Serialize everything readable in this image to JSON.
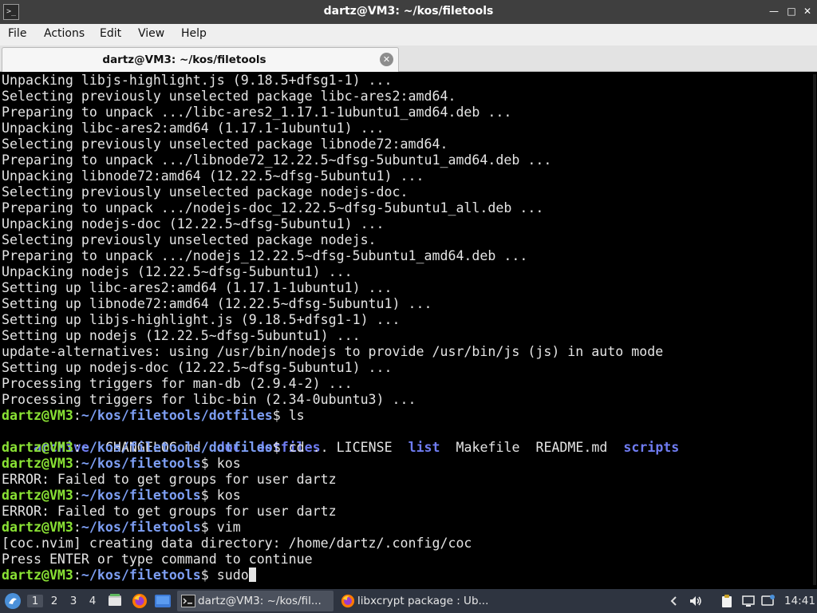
{
  "window": {
    "title": "dartz@VM3: ~/kos/filetools",
    "icon_glyph": ">_"
  },
  "menu": {
    "items": [
      "File",
      "Actions",
      "Edit",
      "View",
      "Help"
    ]
  },
  "tab": {
    "label": "dartz@VM3: ~/kos/filetools"
  },
  "terminal": {
    "output_lines": [
      "Unpacking libjs-highlight.js (9.18.5+dfsg1-1) ...",
      "Selecting previously unselected package libc-ares2:amd64.",
      "Preparing to unpack .../libc-ares2_1.17.1-1ubuntu1_amd64.deb ...",
      "Unpacking libc-ares2:amd64 (1.17.1-1ubuntu1) ...",
      "Selecting previously unselected package libnode72:amd64.",
      "Preparing to unpack .../libnode72_12.22.5~dfsg-5ubuntu1_amd64.deb ...",
      "Unpacking libnode72:amd64 (12.22.5~dfsg-5ubuntu1) ...",
      "Selecting previously unselected package nodejs-doc.",
      "Preparing to unpack .../nodejs-doc_12.22.5~dfsg-5ubuntu1_all.deb ...",
      "Unpacking nodejs-doc (12.22.5~dfsg-5ubuntu1) ...",
      "Selecting previously unselected package nodejs.",
      "Preparing to unpack .../nodejs_12.22.5~dfsg-5ubuntu1_amd64.deb ...",
      "Unpacking nodejs (12.22.5~dfsg-5ubuntu1) ...",
      "Setting up libc-ares2:amd64 (1.17.1-1ubuntu1) ...",
      "Setting up libnode72:amd64 (12.22.5~dfsg-5ubuntu1) ...",
      "Setting up libjs-highlight.js (9.18.5+dfsg1-1) ...",
      "Setting up nodejs (12.22.5~dfsg-5ubuntu1) ...",
      "update-alternatives: using /usr/bin/nodejs to provide /usr/bin/js (js) in auto mode",
      "Setting up nodejs-doc (12.22.5~dfsg-5ubuntu1) ...",
      "Processing triggers for man-db (2.9.4-2) ...",
      "Processing triggers for libc-bin (2.34-0ubuntu3) ..."
    ],
    "prompt_user": "dartz@VM3",
    "prompt_sep": ":",
    "prompt_path_dotfiles": "~/kos/filetools/dotfiles",
    "prompt_path_filetools": "~/kos/filetools",
    "prompt_end": "$ ",
    "cmd_ls": "ls",
    "ls_entries": [
      {
        "name": "archive",
        "dir": true
      },
      {
        "name": "CHANGELOG.md",
        "dir": false
      },
      {
        "name": "doc",
        "dir": true
      },
      {
        "name": "dotfiles",
        "dir": true
      },
      {
        "name": "LICENSE",
        "dir": false
      },
      {
        "name": "list",
        "dir": true
      },
      {
        "name": "Makefile",
        "dir": false
      },
      {
        "name": "README.md",
        "dir": false
      },
      {
        "name": "scripts",
        "dir": true
      }
    ],
    "cmd_cd": "cd ..",
    "cmd_kos": "kos",
    "error_groups": "ERROR: Failed to get groups for user dartz",
    "cmd_vim": "vim",
    "coc_msg": "[coc.nvim] creating data directory: /home/dartz/.config/coc",
    "press_enter": "Press ENTER or type command to continue",
    "cmd_current": "sudo"
  },
  "taskbar": {
    "workspaces": [
      "1",
      "2",
      "3",
      "4"
    ],
    "active_workspace": "1",
    "tasks": [
      {
        "label": "dartz@VM3: ~/kos/fil...",
        "icon": "terminal-icon"
      },
      {
        "label": "libxcrypt package : Ub...",
        "icon": "firefox-icon"
      }
    ],
    "clock": "14:41"
  },
  "colors": {
    "prompt_user": "#8ae234",
    "prompt_path": "#7d9ef3",
    "directory": "#6f7cf2",
    "taskbar_bg": "#2e3440",
    "titlebar_bg": "#3f3f3f"
  }
}
